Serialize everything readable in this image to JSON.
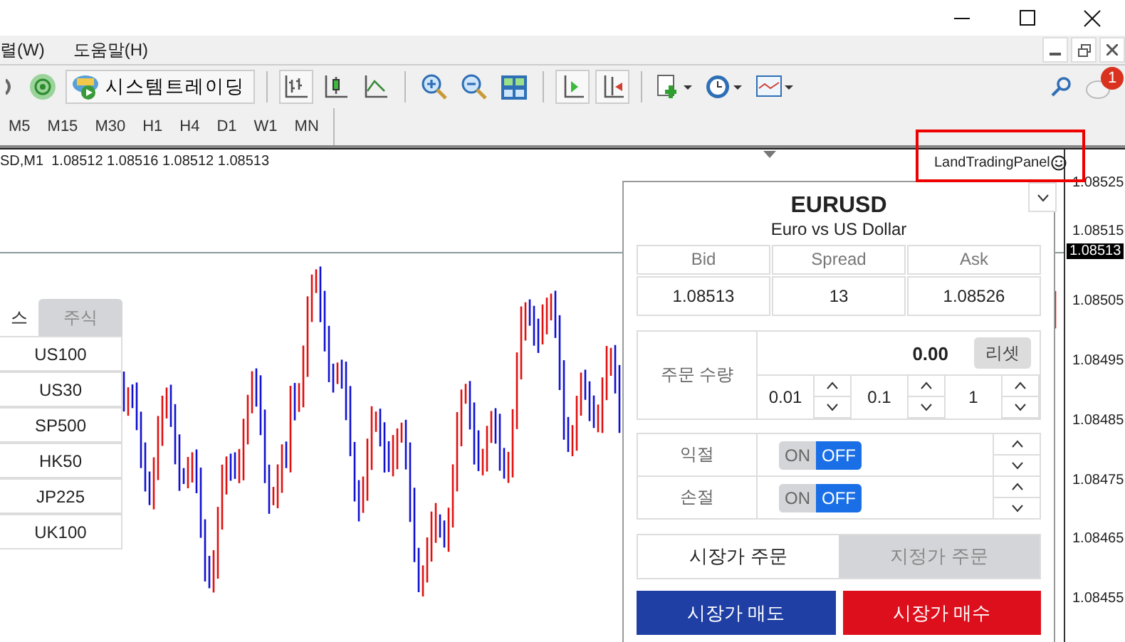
{
  "menu": [
    {
      "label": "렬(W)"
    },
    {
      "label": "도움말(H)"
    }
  ],
  "toolbar": {
    "system_trading_button": "시스템트레이딩",
    "notification_count": "1"
  },
  "timeframes": [
    "M5",
    "M15",
    "M30",
    "H1",
    "H4",
    "D1",
    "W1",
    "MN"
  ],
  "chart": {
    "header": "SD,M1  1.08512 1.08516 1.08512 1.08513",
    "indicator_label": "LandTradingPanel",
    "current_price": "1.08513",
    "price_labels": [
      "1.08525",
      "1.08515",
      "1.08505",
      "1.08495",
      "1.08485",
      "1.08475",
      "1.08465",
      "1.08455"
    ]
  },
  "symbol_panel": {
    "tabs": [
      {
        "label": "스",
        "selected": true
      },
      {
        "label": "주식",
        "selected": false
      }
    ],
    "items": [
      "US100",
      "US30",
      "SP500",
      "HK50",
      "JP225",
      "UK100"
    ]
  },
  "trading_panel": {
    "symbol": "EURUSD",
    "description": "Euro vs US Dollar",
    "quote": {
      "columns": [
        "Bid",
        "Spread",
        "Ask"
      ],
      "values": [
        "1.08513",
        "13",
        "1.08526"
      ]
    },
    "order_quantity": {
      "label": "주문 수량",
      "value": "0.00",
      "reset_button": "리셋",
      "steps": [
        "0.01",
        "0.1",
        "1"
      ]
    },
    "stops": [
      {
        "label": "익절",
        "on_label": "ON",
        "off_label": "OFF",
        "on": false
      },
      {
        "label": "손절",
        "on_label": "ON",
        "off_label": "OFF",
        "on": false
      }
    ],
    "order_tabs": [
      {
        "label": "시장가 주문",
        "selected": true
      },
      {
        "label": "지정가 주문",
        "selected": false
      }
    ],
    "actions": [
      {
        "label": "시장가 매도",
        "kind": "sell"
      },
      {
        "label": "시장가 매수",
        "kind": "buy"
      }
    ]
  }
}
